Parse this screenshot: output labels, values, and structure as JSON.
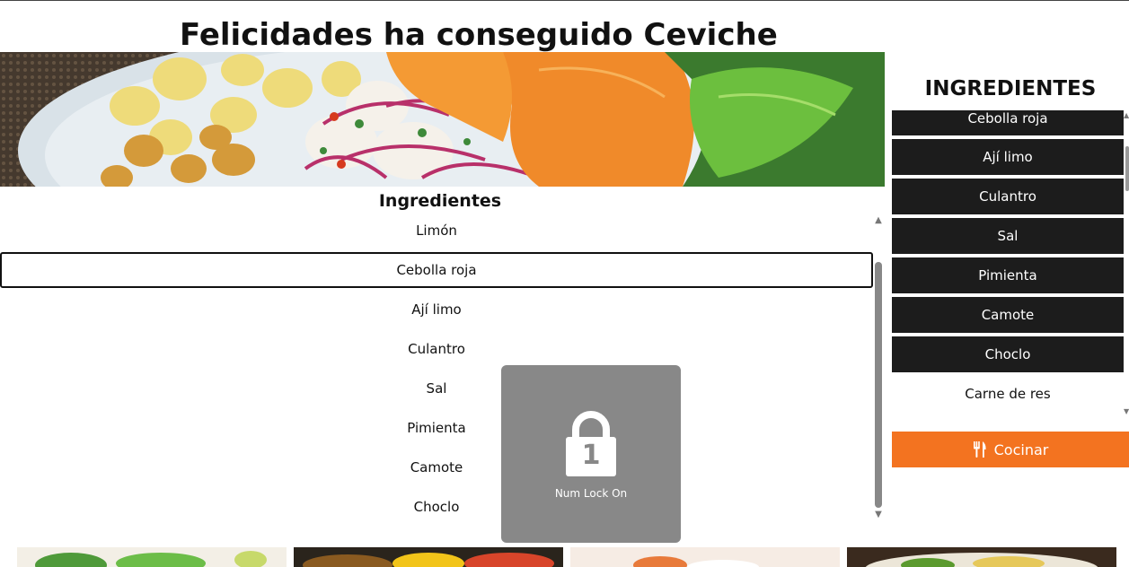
{
  "page": {
    "title": "Felicidades ha conseguido Ceviche"
  },
  "hero": {
    "icon": "ceviche-photo"
  },
  "recipe": {
    "heading": "Ingredientes",
    "items": [
      "Limón",
      "Cebolla roja",
      "Ají limo",
      "Culantro",
      "Sal",
      "Pimienta",
      "Camote",
      "Choclo"
    ],
    "selected_index": 1
  },
  "overlay": {
    "icon": "lock-icon",
    "digit": "1",
    "label": "Num Lock On"
  },
  "sidebar": {
    "title": "INGREDIENTES",
    "items": [
      "Cebolla roja",
      "Ají limo",
      "Culantro",
      "Sal",
      "Pimienta",
      "Camote",
      "Choclo",
      "Carne de res"
    ],
    "cook_label": "Cocinar",
    "cook_icon": "utensils-icon",
    "cook_color": "#f37320"
  },
  "gallery": {
    "icons": [
      "salad-photo",
      "dish-photo",
      "plate-photo",
      "bowl-photo"
    ]
  }
}
